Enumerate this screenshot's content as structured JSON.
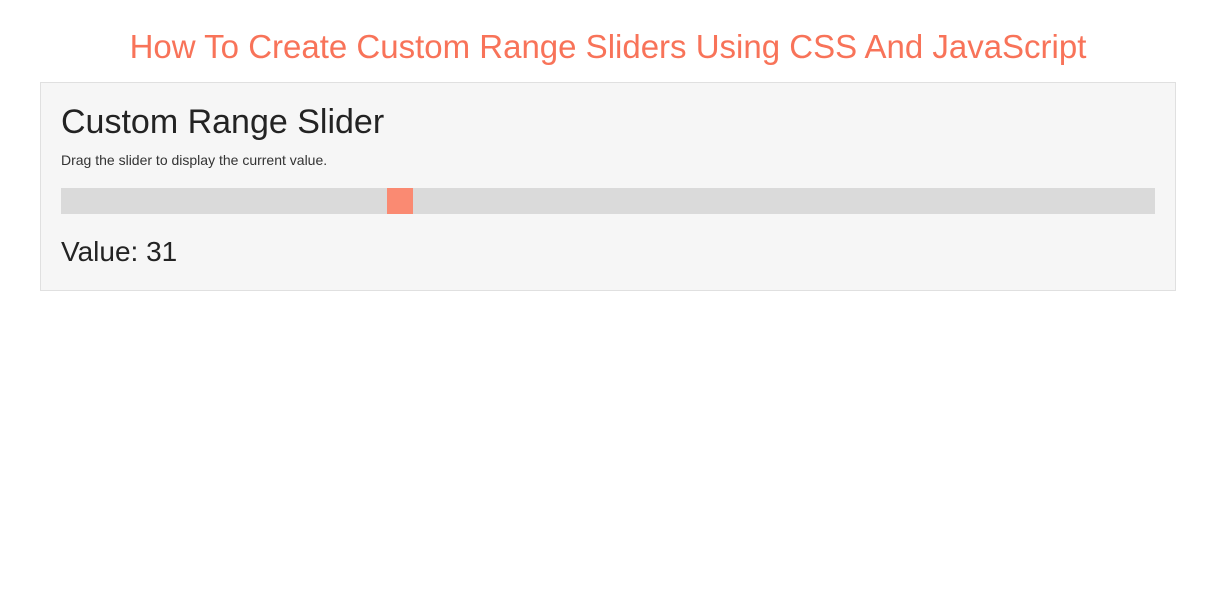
{
  "page": {
    "title": "How To Create Custom Range Sliders Using CSS And JavaScript"
  },
  "panel": {
    "heading": "Custom Range Slider",
    "description": "Drag the slider to display the current value.",
    "slider": {
      "min": 0,
      "max": 100,
      "value": 31
    },
    "value_label_prefix": "Value: ",
    "value_display": "Value: 31"
  },
  "colors": {
    "accent": "#f87359",
    "thumb": "#fa8a72",
    "track": "#dadada",
    "panel_bg": "#f6f6f6"
  }
}
